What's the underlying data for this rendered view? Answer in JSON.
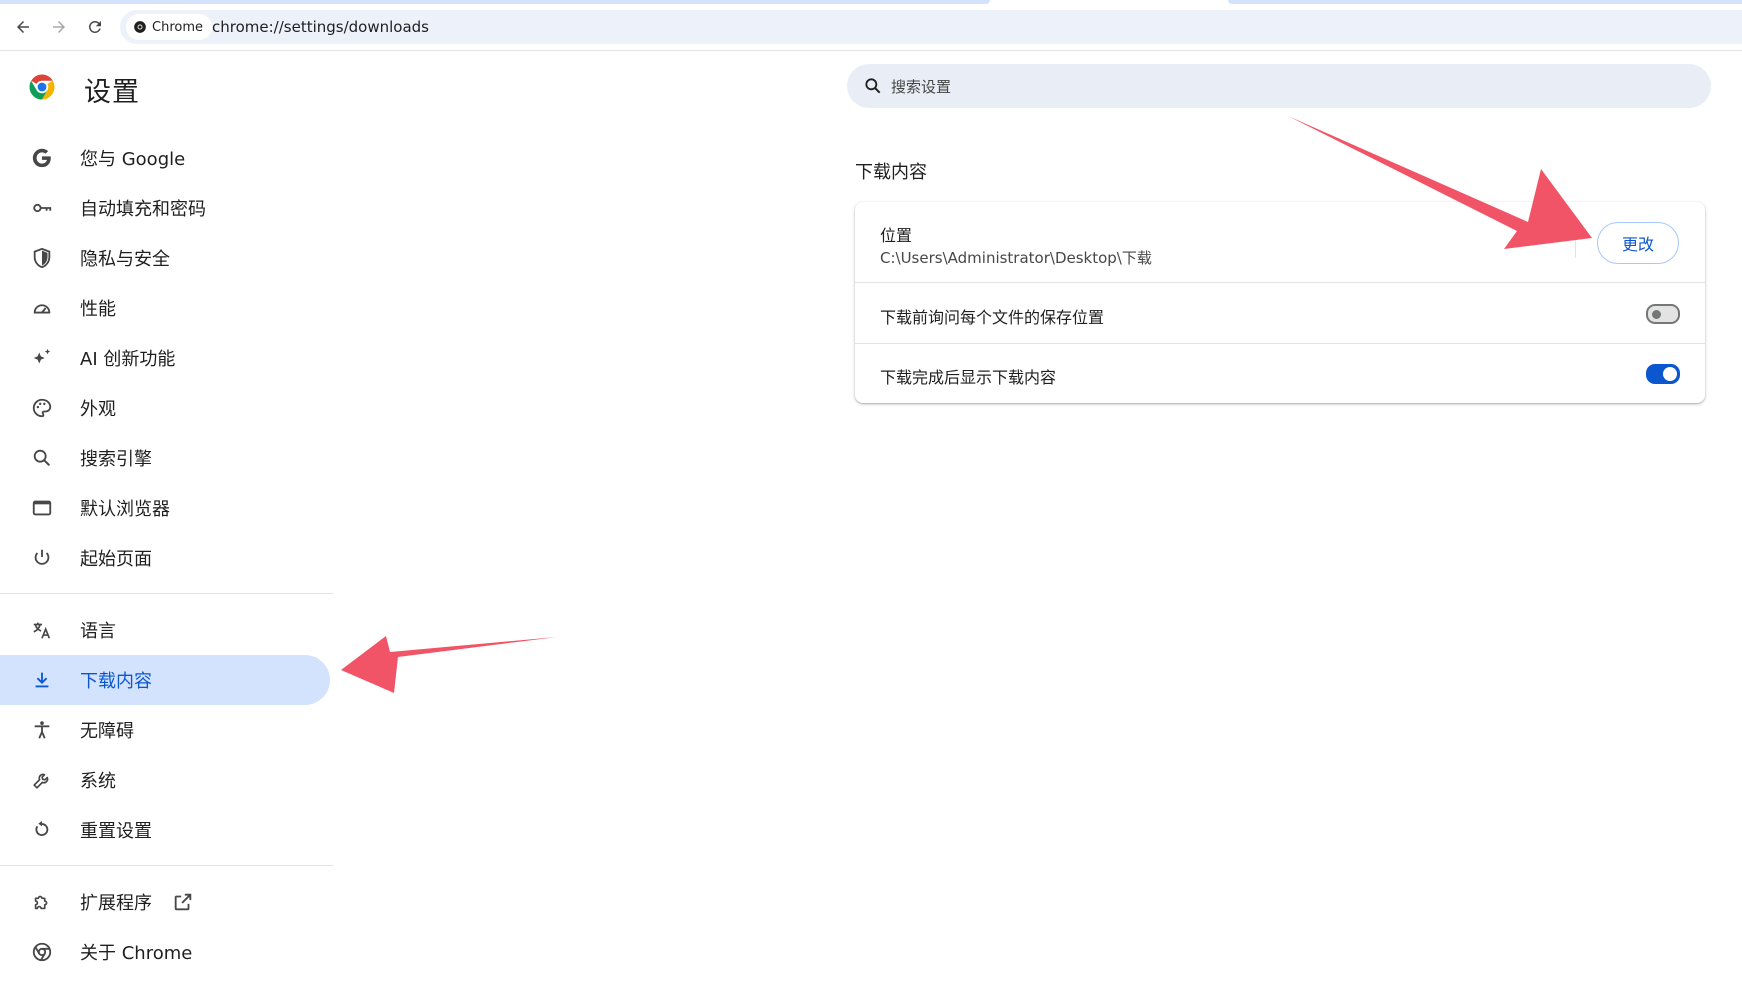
{
  "browser": {
    "chip_label": "Chrome",
    "url": "chrome://settings/downloads"
  },
  "sidebar": {
    "title": "设置",
    "items": [
      {
        "label": "您与 Google",
        "icon": "google-icon"
      },
      {
        "label": "自动填充和密码",
        "icon": "key-icon"
      },
      {
        "label": "隐私与安全",
        "icon": "shield-icon"
      },
      {
        "label": "性能",
        "icon": "speedometer-icon"
      },
      {
        "label": "AI 创新功能",
        "icon": "sparkle-icon"
      },
      {
        "label": "外观",
        "icon": "palette-icon"
      },
      {
        "label": "搜索引擎",
        "icon": "search-icon"
      },
      {
        "label": "默认浏览器",
        "icon": "browser-window-icon"
      },
      {
        "label": "起始页面",
        "icon": "power-icon"
      },
      {
        "label": "语言",
        "icon": "translate-icon"
      },
      {
        "label": "下载内容",
        "icon": "download-icon",
        "active": true
      },
      {
        "label": "无障碍",
        "icon": "accessibility-icon"
      },
      {
        "label": "系统",
        "icon": "wrench-icon"
      },
      {
        "label": "重置设置",
        "icon": "reset-icon"
      },
      {
        "label": "扩展程序",
        "icon": "puzzle-icon"
      },
      {
        "label": "关于 Chrome",
        "icon": "chrome-icon"
      }
    ]
  },
  "search": {
    "placeholder": "搜索设置"
  },
  "main": {
    "section_title": "下载内容",
    "location_label": "位置",
    "location_path": "C:\\Users\\Administrator\\Desktop\\下载",
    "change_button": "更改",
    "ask_where_label": "下载前询问每个文件的保存位置",
    "ask_where_enabled": false,
    "show_downloads_label": "下载完成后显示下载内容",
    "show_downloads_enabled": true
  },
  "colors": {
    "accent": "#0b57d0",
    "active_nav_bg": "#d3e3fd",
    "annotation_arrow": "#f25467"
  }
}
